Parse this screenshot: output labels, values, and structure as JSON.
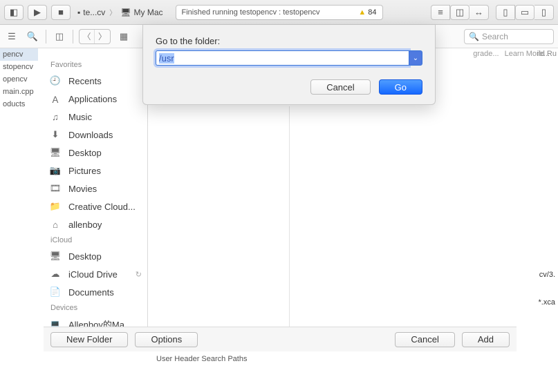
{
  "toolbar": {
    "breadcrumb_project": "te...cv",
    "breadcrumb_target": "My Mac",
    "status_text": "Finished running testopencv : testopencv",
    "warning_count": "84"
  },
  "row2": {
    "search_placeholder": "Search",
    "link_upgrade": "grade...",
    "link_learn": "Learn More..."
  },
  "leftnav": {
    "items": [
      "pencv",
      "stopencv",
      "opencv",
      "main.cpp",
      "oducts"
    ]
  },
  "sidebar": {
    "section_favorites": "Favorites",
    "items_fav": [
      {
        "icon": "clock",
        "label": "Recents"
      },
      {
        "icon": "app",
        "label": "Applications"
      },
      {
        "icon": "music",
        "label": "Music"
      },
      {
        "icon": "download",
        "label": "Downloads"
      },
      {
        "icon": "desktop",
        "label": "Desktop"
      },
      {
        "icon": "camera",
        "label": "Pictures"
      },
      {
        "icon": "film",
        "label": "Movies"
      },
      {
        "icon": "folder",
        "label": "Creative Cloud..."
      },
      {
        "icon": "home",
        "label": "allenboy"
      }
    ],
    "section_icloud": "iCloud",
    "items_icloud": [
      {
        "icon": "desktop",
        "label": "Desktop"
      },
      {
        "icon": "cloud",
        "label": "iCloud Drive",
        "tail": "↻"
      },
      {
        "icon": "doc",
        "label": "Documents"
      }
    ],
    "section_devices": "Devices",
    "items_devices": [
      {
        "icon": "disk",
        "label": "Allenboy的Ma..."
      }
    ]
  },
  "goto": {
    "label": "Go to the folder:",
    "value": "/usr",
    "cancel": "Cancel",
    "go": "Go"
  },
  "bottom": {
    "new_folder": "New Folder",
    "options": "Options",
    "cancel": "Cancel",
    "add": "Add"
  },
  "rightedge": {
    "line1": "cv/3.",
    "line2": "*.xca"
  },
  "bottomright": {
    "buildrun": "ild Ru"
  },
  "under": "User Header Search Paths"
}
